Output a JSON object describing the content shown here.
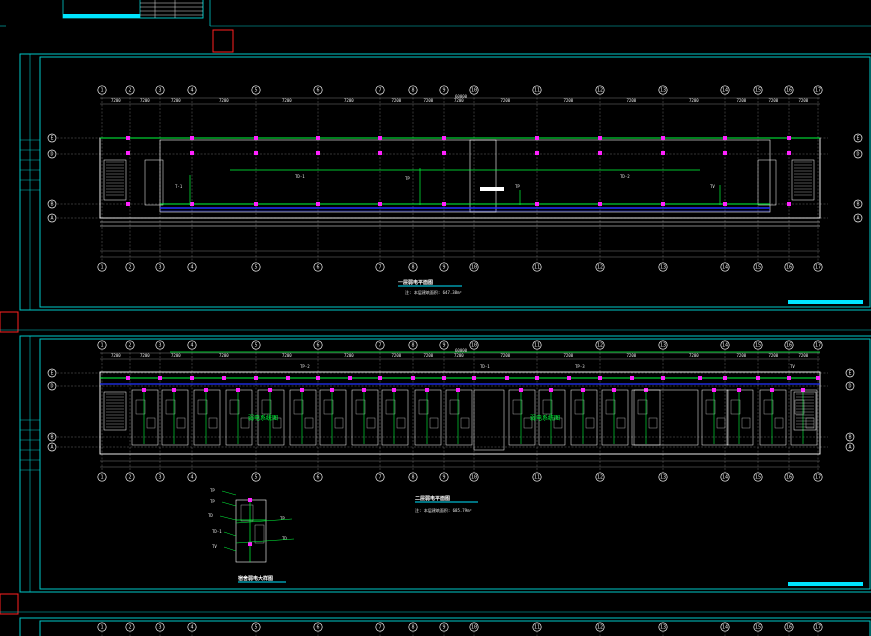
{
  "colors": {
    "background": "#000000",
    "frame": "#00c8c8",
    "grid": "#9a9a9a",
    "wall": "#ffffff",
    "green": "#00ff3c",
    "blue": "#2233ff",
    "magenta": "#ff22ff",
    "red": "#ff2020",
    "title_bar": "#00e5ff"
  },
  "plan1": {
    "axis_numbers": [
      "1",
      "2",
      "3",
      "4",
      "5",
      "6",
      "7",
      "8",
      "9",
      "10",
      "11",
      "12",
      "13",
      "14",
      "15",
      "16",
      "17",
      "18",
      "19"
    ],
    "row_letters": [
      "E",
      "D",
      "B",
      "A"
    ],
    "label_top": "60000",
    "title": "一层弱电平面图",
    "note": "注: 本层建筑面积: 647.38m²"
  },
  "plan2": {
    "axis_numbers": [
      "1",
      "2",
      "3",
      "4",
      "5",
      "6",
      "7",
      "8",
      "9",
      "10",
      "11",
      "12",
      "13",
      "14",
      "15",
      "16",
      "17",
      "18",
      "19"
    ],
    "row_letters": [
      "E",
      "D",
      "B",
      "A"
    ],
    "label_top": "60000",
    "room_label_left": "弱电系统图",
    "room_label_right": "弱电系统图",
    "title": "二层弱电平面图",
    "note": "注: 本层建筑面积: 685.79m²"
  },
  "detail": {
    "title": "宿舍弱电大样图"
  },
  "plan3": {
    "axis_numbers": [
      "1",
      "2",
      "3",
      "4",
      "5",
      "6",
      "7",
      "8",
      "9",
      "10",
      "11",
      "12",
      "13",
      "14",
      "15",
      "16",
      "17",
      "18",
      "19"
    ]
  }
}
